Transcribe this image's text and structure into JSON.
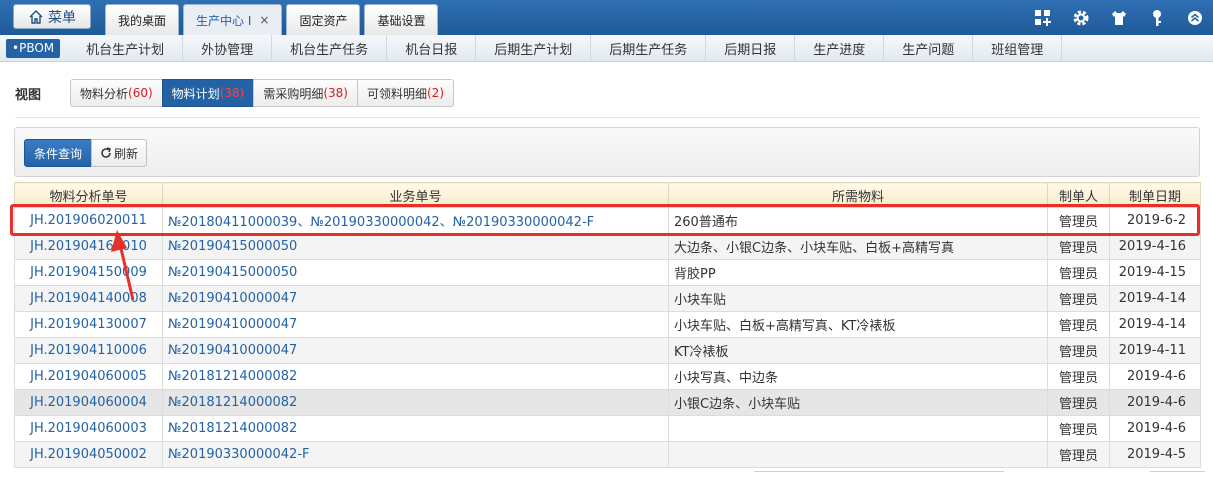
{
  "header": {
    "menu_label": "菜单",
    "tabs": [
      {
        "label": "我的桌面",
        "active": false
      },
      {
        "label": "生产中心 I",
        "active": true,
        "close": "×"
      },
      {
        "label": "固定资产",
        "active": false
      },
      {
        "label": "基础设置",
        "active": false
      }
    ],
    "icons": [
      "grid-plus-icon",
      "gear-icon",
      "shirt-icon",
      "key-icon",
      "chevron-up-circle-icon"
    ]
  },
  "nav": {
    "badge": "•PBOM",
    "items": [
      "机台生产计划",
      "外协管理",
      "机台生产任务",
      "机台日报",
      "后期生产计划",
      "后期生产任务",
      "后期日报",
      "生产进度",
      "生产问题",
      "班组管理"
    ]
  },
  "view": {
    "label": "视图",
    "tabs": [
      {
        "name": "物料分析",
        "count": "(60)",
        "active": false
      },
      {
        "name": "物料计划",
        "count": "(38)",
        "active": true
      },
      {
        "name": "需采购明细",
        "count": "(38)",
        "active": false
      },
      {
        "name": "可领料明细",
        "count": "(2)",
        "active": false
      }
    ]
  },
  "toolbar": {
    "query_label": "条件查询",
    "refresh_label": "刷新"
  },
  "table": {
    "columns": [
      "物料分析单号",
      "业务单号",
      "所需物料",
      "制单人",
      "制单日期"
    ],
    "rows": [
      [
        "JH.201906020011",
        "№20180411000039、№20190330000042、№20190330000042-F",
        "260普通布",
        "管理员",
        "2019-6-2"
      ],
      [
        "JH.201904160010",
        "№20190415000050",
        "大边条、小银C边条、小块车贴、白板+高精写真",
        "管理员",
        "2019-4-16"
      ],
      [
        "JH.201904150009",
        "№20190415000050",
        "背胶PP",
        "管理员",
        "2019-4-15"
      ],
      [
        "JH.201904140008",
        "№20190410000047",
        "小块车贴",
        "管理员",
        "2019-4-14"
      ],
      [
        "JH.201904130007",
        "№20190410000047",
        "小块车贴、白板+高精写真、KT冷裱板",
        "管理员",
        "2019-4-14"
      ],
      [
        "JH.201904110006",
        "№20190410000047",
        "KT冷裱板",
        "管理员",
        "2019-4-11"
      ],
      [
        "JH.201904060005",
        "№20181214000082",
        "小块写真、中边条",
        "管理员",
        "2019-4-6"
      ],
      [
        "JH.201904060004",
        "№20181214000082",
        "小银C边条、小块车贴",
        "管理员",
        "2019-4-6"
      ],
      [
        "JH.201904060003",
        "№20181214000082",
        "",
        "管理员",
        "2019-4-6"
      ],
      [
        "JH.201904050002",
        "№20190330000042-F",
        "",
        "管理员",
        "2019-4-5"
      ]
    ]
  },
  "colors": {
    "accent": "#2462a6",
    "highlight": "#e8302a",
    "count": "#d01f1f"
  }
}
